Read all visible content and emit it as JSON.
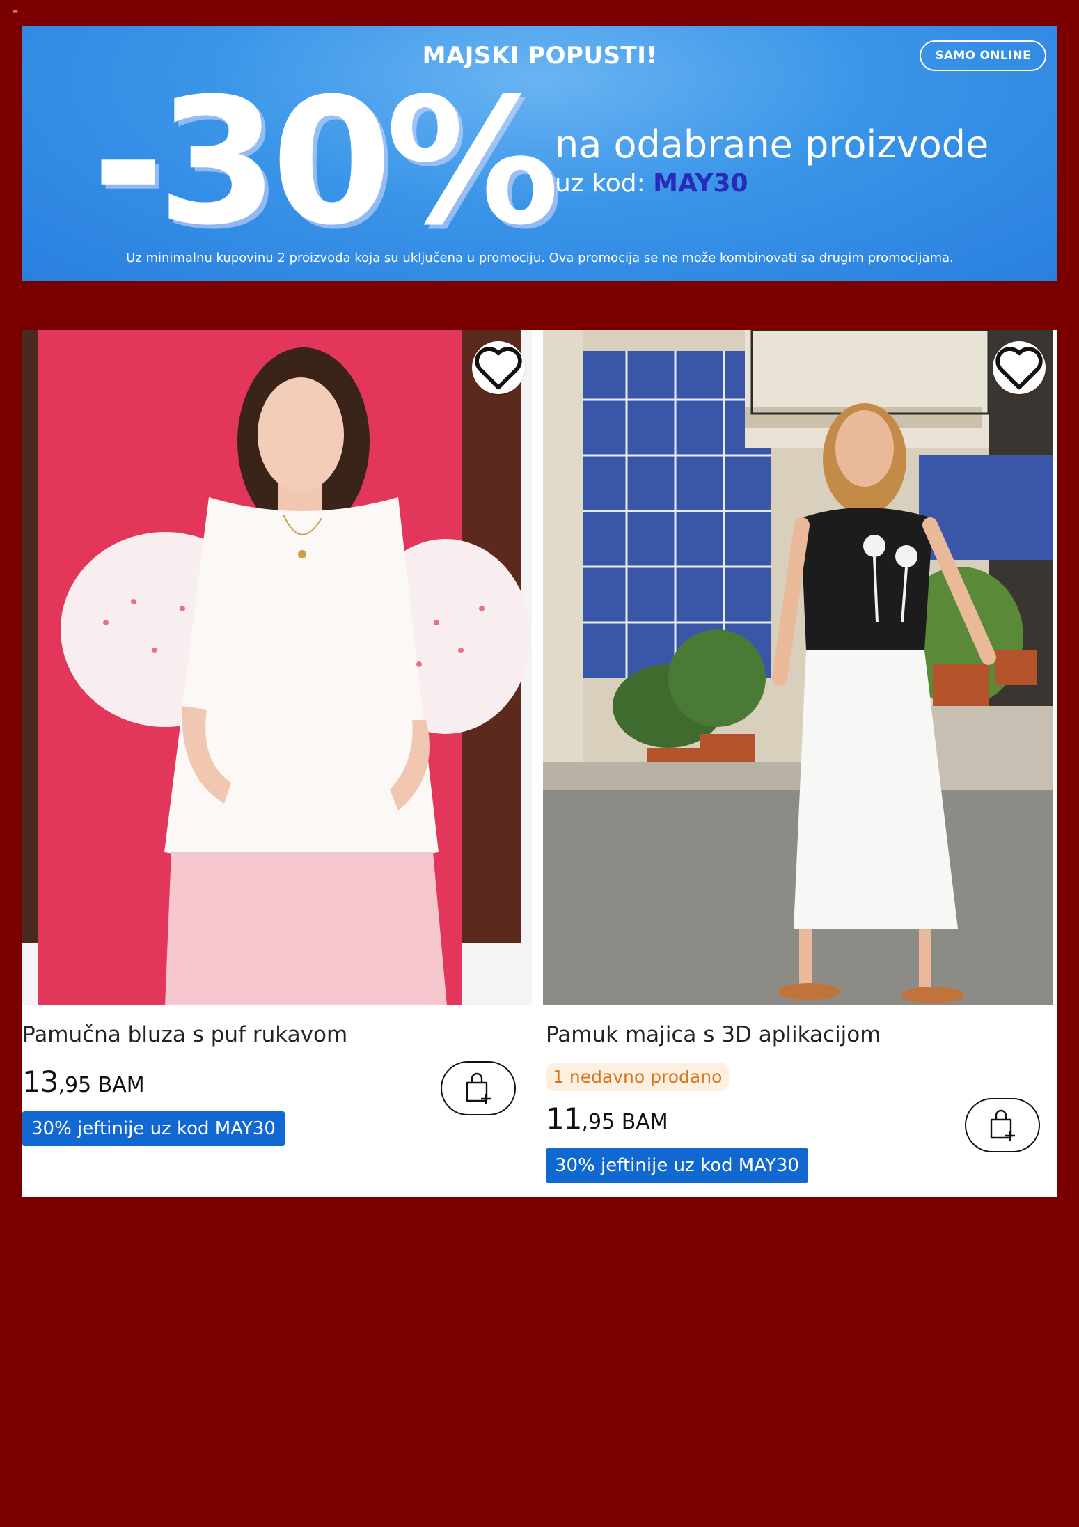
{
  "page": {
    "menu_icon": "menu-icon"
  },
  "banner": {
    "title": "MAJSKI POPUSTI!",
    "badge": "SAMO ONLINE",
    "discount": "-30%",
    "headline": "na odabrane proizvode",
    "code_prefix": "uz kod: ",
    "code": "MAY30",
    "note": "Uz minimalnu kupovinu 2 proizvoda koja su uključena u promociju. Ova promocija se ne može kombinovati sa drugim promocijama."
  },
  "products": [
    {
      "name": "Pamučna bluza s puf rukavom",
      "price_int": "13",
      "price_rest": ",95 BAM",
      "promo": "30% jeftinije uz kod MAY30",
      "sold": ""
    },
    {
      "name": "Pamuk majica s 3D aplikacijom",
      "sold": "1 nedavno prodano",
      "price_int": "11",
      "price_rest": ",95 BAM",
      "promo": "30% jeftinije uz kod MAY30"
    }
  ],
  "colors": {
    "page_bg": "#7a0000",
    "banner_blue": "#2a7fdf",
    "code_badge": "#1068d0",
    "sold_badge_text": "#d9731a"
  }
}
